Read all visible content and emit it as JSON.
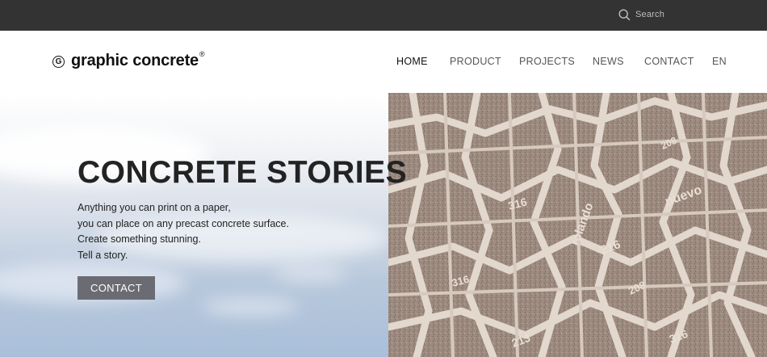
{
  "topbar": {
    "search": {
      "icon": "search-icon",
      "label": "Search"
    }
  },
  "header": {
    "logo": {
      "mark": "G",
      "text": "graphic concrete",
      "registered": "®"
    },
    "nav": [
      {
        "label": "HOME",
        "active": true
      },
      {
        "label": "PRODUCT",
        "active": false
      },
      {
        "label": "PROJECTS",
        "active": false
      },
      {
        "label": "NEWS",
        "active": false
      },
      {
        "label": "CONTACT",
        "active": false
      },
      {
        "label": "EN",
        "active": false
      }
    ]
  },
  "hero": {
    "title": "CONCRETE STORIES",
    "lines": [
      "Anything you can print on a paper,",
      "you can place on any precast concrete surface.",
      "Create something stunning.",
      "Tell a story."
    ],
    "button_label": "CONTACT",
    "image_labels": [
      "316",
      "216",
      "208",
      "213",
      "316",
      "316",
      "208",
      "nuevo",
      "rolando"
    ]
  },
  "colors": {
    "topbar_bg": "#333333",
    "button_bg": "#6b6c73",
    "text_dark": "#232323",
    "nav_text": "#555555",
    "concrete_bg": "#a59489",
    "concrete_lines": "#e3d8ce"
  }
}
